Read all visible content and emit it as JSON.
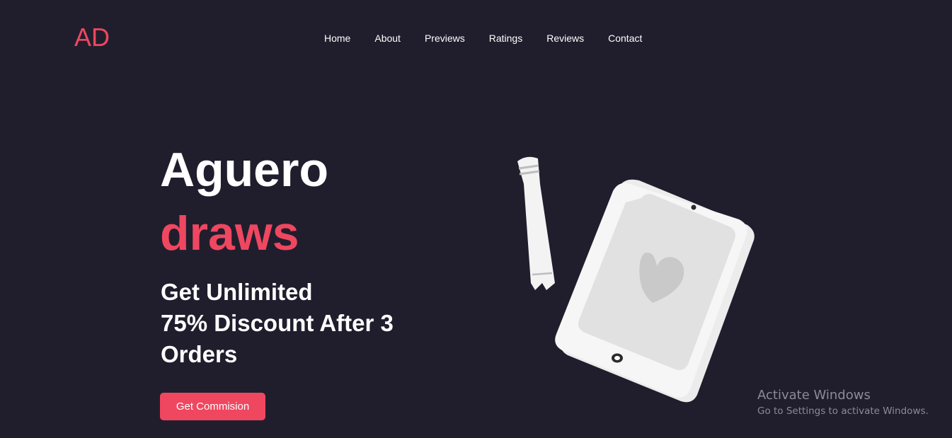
{
  "header": {
    "logo_text": "AD",
    "nav": [
      {
        "label": "Home"
      },
      {
        "label": "About"
      },
      {
        "label": "Previews"
      },
      {
        "label": "Ratings"
      },
      {
        "label": "Reviews"
      },
      {
        "label": "Contact"
      }
    ]
  },
  "hero": {
    "title_line1": "Aguero",
    "title_line2": "draws",
    "subtitle_lines": [
      "Get Unlimited",
      "75% Discount After 3",
      "Orders"
    ],
    "cta_label": "Get Commision"
  },
  "illustration": {
    "icons": [
      "tablet-icon",
      "stylus-icon",
      "heart-icon"
    ]
  },
  "os_watermark": {
    "title": "Activate Windows",
    "subtitle": "Go to Settings to activate Windows."
  },
  "colors": {
    "background": "#201e2d",
    "accent": "#ef4760",
    "text": "#ffffff"
  }
}
